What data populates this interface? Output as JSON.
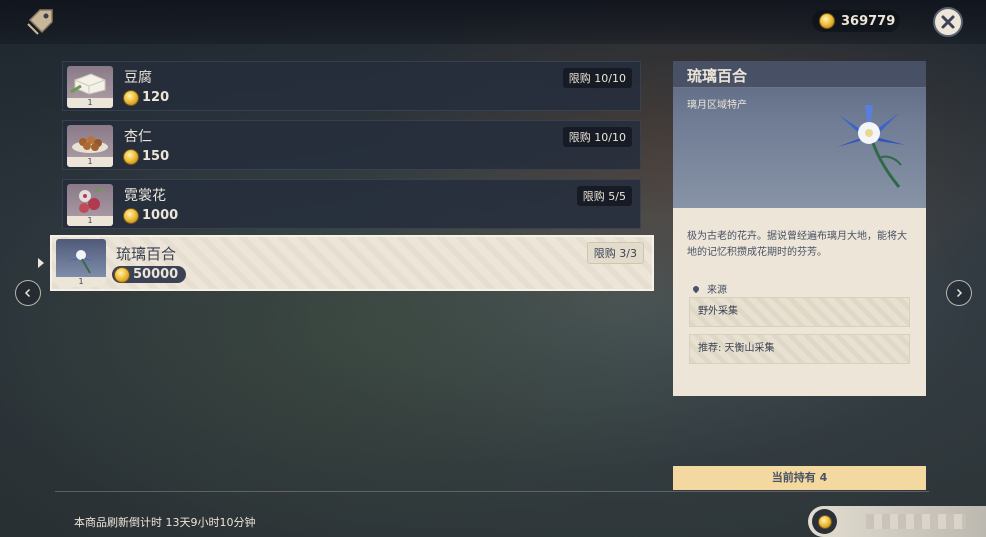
{
  "header": {
    "currency_value": "369779"
  },
  "items": [
    {
      "name": "豆腐",
      "price": "120",
      "limit": "限购 10/10",
      "qty": "1"
    },
    {
      "name": "杏仁",
      "price": "150",
      "limit": "限购 10/10",
      "qty": "1"
    },
    {
      "name": "霓裳花",
      "price": "1000",
      "limit": "限购 5/5",
      "qty": "1"
    },
    {
      "name": "琉璃百合",
      "price": "50000",
      "limit": "限购 3/3",
      "qty": "1"
    }
  ],
  "detail": {
    "title": "琉璃百合",
    "subtitle": "璃月区域特产",
    "description": "极为古老的花卉。据说曾经遍布璃月大地，能将大地的记忆积攒成花期时的芬芳。",
    "source_label": "来源",
    "sources": [
      "野外采集",
      "推荐: 天衡山采集"
    ],
    "holding": "当前持有 4"
  },
  "footer": {
    "refresh_text": "本商品刷新倒计时 13天9小时10分钟"
  },
  "colors": {
    "panel_light": "#ece5d8",
    "text_dark": "#3b4255",
    "gold": "#f0c040",
    "holding_bg": "#f3d9a0"
  }
}
